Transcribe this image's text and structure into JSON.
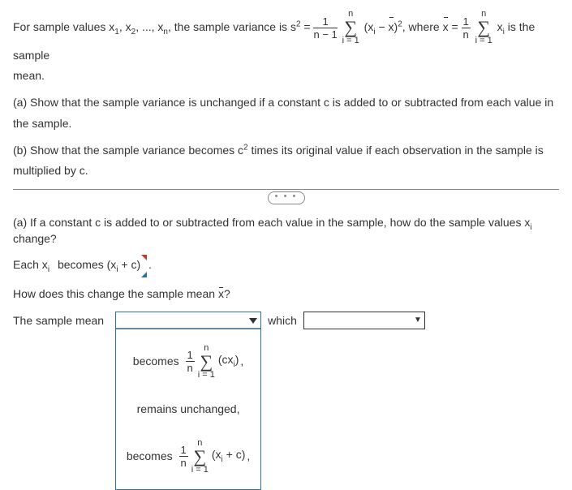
{
  "intro": {
    "lead": "For sample values x",
    "sub1": "1",
    "sep1": ", x",
    "sub2": "2",
    "sep2": ", ..., x",
    "subn": "n",
    "after_list": ", the sample variance is s",
    "sq": "2",
    "eq": " = ",
    "frac1_num": "1",
    "frac1_den": "n − 1",
    "sum1_upper": "n",
    "sum1_lower": "i = 1",
    "term1_open": "(x",
    "term1_sub": "i",
    "term1_mid": " − ",
    "term1_xbar": "x",
    "term1_close": ")",
    "term1_sq": "2",
    "where": ", where ",
    "xbar2": "x",
    "eq2": " = ",
    "frac2_num": "1",
    "frac2_den": "n",
    "sum2_upper": "n",
    "sum2_lower": "i = 1",
    "term2_x": " x",
    "term2_sub": "i",
    "tail": " is the sample",
    "mean_word": "mean."
  },
  "parts": {
    "a": "(a) Show that the sample variance is unchanged if a constant c is added to or subtracted from each value in the sample.",
    "b": "(b) Show that the sample variance becomes c",
    "b_sq": "2",
    "b_tail": " times its original value if each observation in the sample is multiplied by c."
  },
  "more_label": "• • •",
  "qa": {
    "q1": "(a) If a constant c is added to or subtracted from each value in the sample, how do the sample values x",
    "q1_sub": "i",
    "q1_tail": " change?",
    "a1_lead": "Each x",
    "a1_sub": "i",
    "a1_answer_pre": "becomes ",
    "a1_answer_open": "(x",
    "a1_answer_sub": "i",
    "a1_answer_mid": " + c)",
    "a1_dot": " .",
    "q2_lead": "How does this change the sample mean ",
    "q2_xbar": "x",
    "q2_tail": "?",
    "a2_label": "The sample mean",
    "a2_which": "which"
  },
  "dropdown": {
    "item1": {
      "word": "becomes",
      "frac_num": "1",
      "frac_den": "n",
      "sum_upper": "n",
      "sum_lower": "i = 1",
      "open": "(cx",
      "sub": "i",
      "close": ")",
      "dot": " ,"
    },
    "item2": "remains unchanged,",
    "item3": {
      "word": "becomes",
      "frac_num": "1",
      "frac_den": "n",
      "sum_upper": "n",
      "sum_lower": "i = 1",
      "open": "(x",
      "sub": "i",
      "mid": " + c)",
      "dot": " ,"
    }
  }
}
